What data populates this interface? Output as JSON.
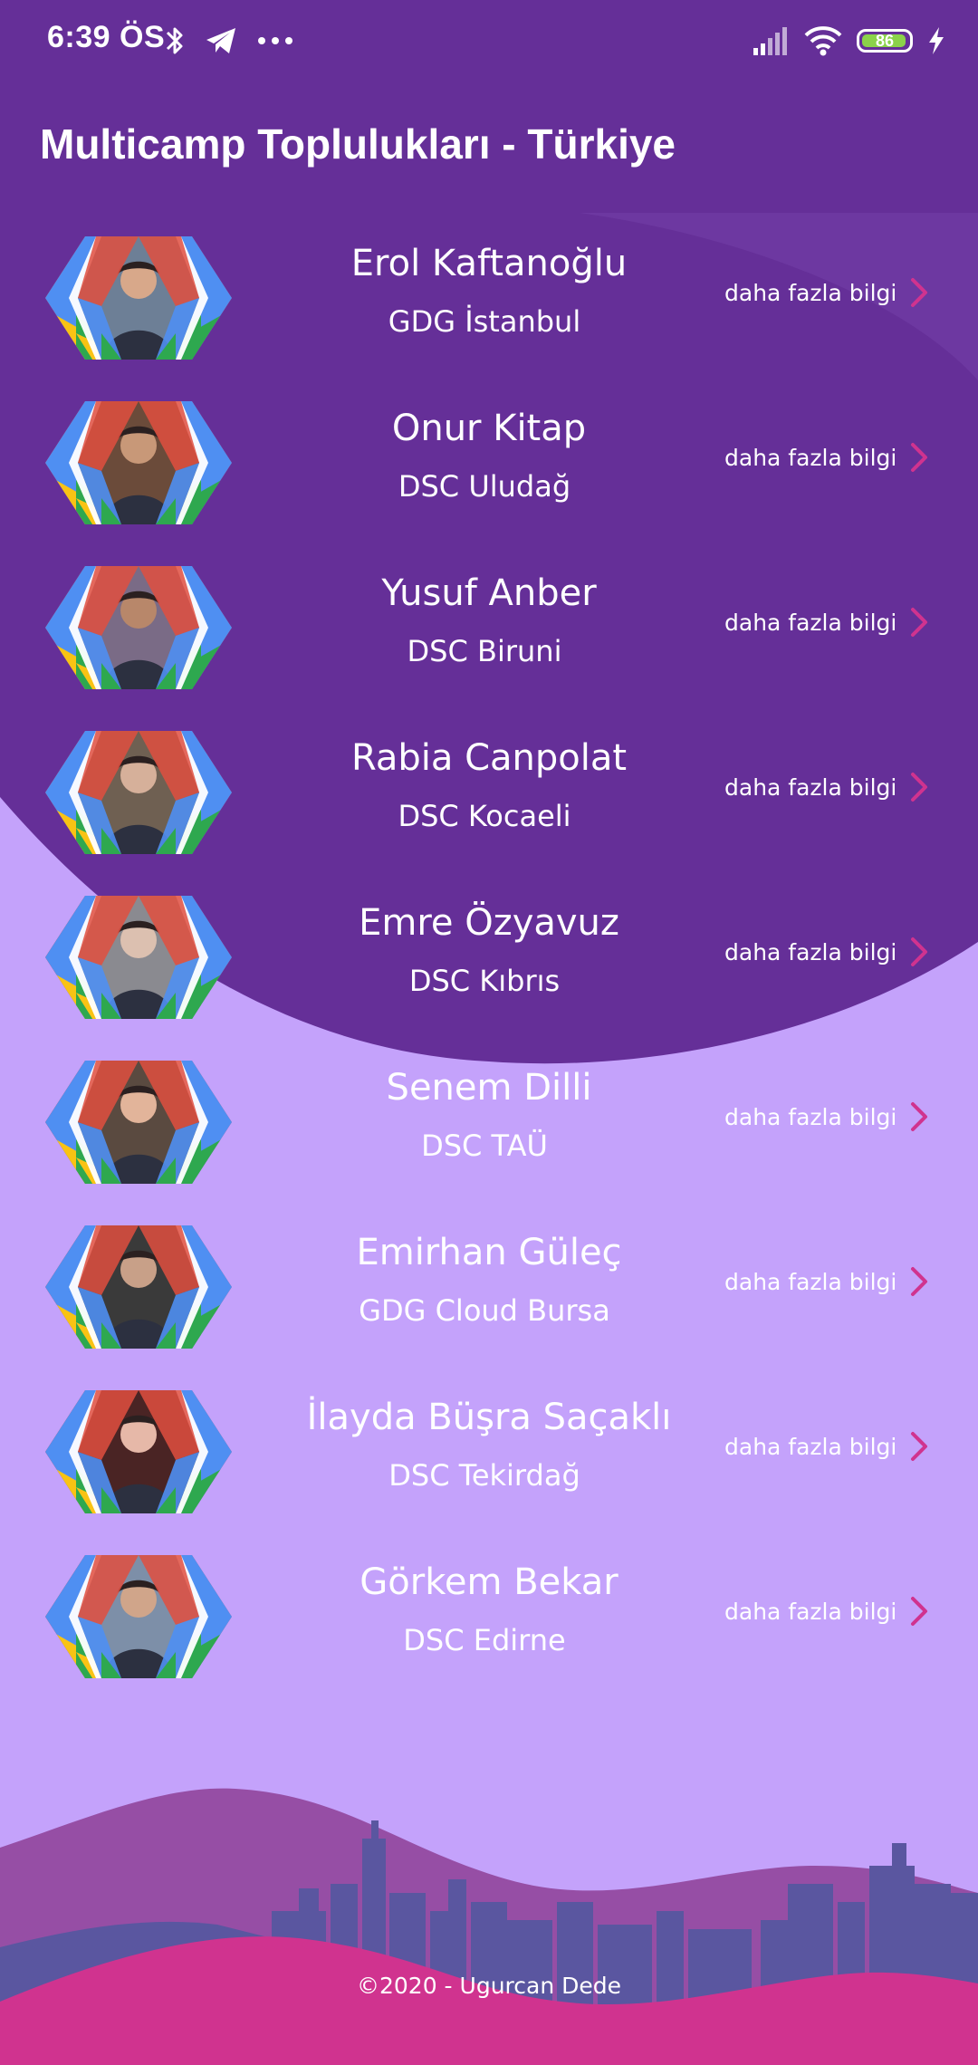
{
  "status_bar": {
    "time": "6:39 ÖS",
    "icons_left": [
      "bluetooth-icon",
      "telegram-icon",
      "more-dots-icon"
    ],
    "icons_right": [
      "signal-icon",
      "wifi-icon",
      "battery-icon",
      "charging-icon"
    ],
    "battery_level": "86"
  },
  "app_bar": {
    "title": "Multicamp Toplulukları - Türkiye"
  },
  "colors": {
    "dark_purple": "#652f98",
    "light_purple": "#c4a2fb",
    "accent_pink": "#d0338f",
    "hex_red": "#e04f3f",
    "hex_blue": "#4f8ff2",
    "hex_green": "#2ea84f",
    "hex_yellow": "#f9c314"
  },
  "members": [
    {
      "name": "Erol Kaftanoğlu",
      "community": "GDG İstanbul",
      "action": "daha fazla bilgi"
    },
    {
      "name": "Onur Kitap",
      "community": "DSC Uludağ",
      "action": "daha fazla bilgi"
    },
    {
      "name": "Yusuf Anber",
      "community": "DSC Biruni",
      "action": "daha fazla bilgi"
    },
    {
      "name": "Rabia Canpolat",
      "community": "DSC Kocaeli",
      "action": "daha fazla bilgi"
    },
    {
      "name": "Emre Özyavuz",
      "community": "DSC Kıbrıs",
      "action": "daha fazla bilgi"
    },
    {
      "name": "Senem Dilli",
      "community": "DSC TAÜ",
      "action": "daha fazla bilgi"
    },
    {
      "name": "Emirhan Güleç",
      "community": "GDG Cloud Bursa",
      "action": "daha fazla bilgi"
    },
    {
      "name": "İlayda Büşra Saçaklı",
      "community": "DSC Tekirdağ",
      "action": "daha fazla bilgi"
    },
    {
      "name": "Görkem Bekar",
      "community": "DSC Edirne",
      "action": "daha fazla bilgi"
    }
  ],
  "footer": {
    "copyright": "©2020 - Ugurcan Dede"
  }
}
